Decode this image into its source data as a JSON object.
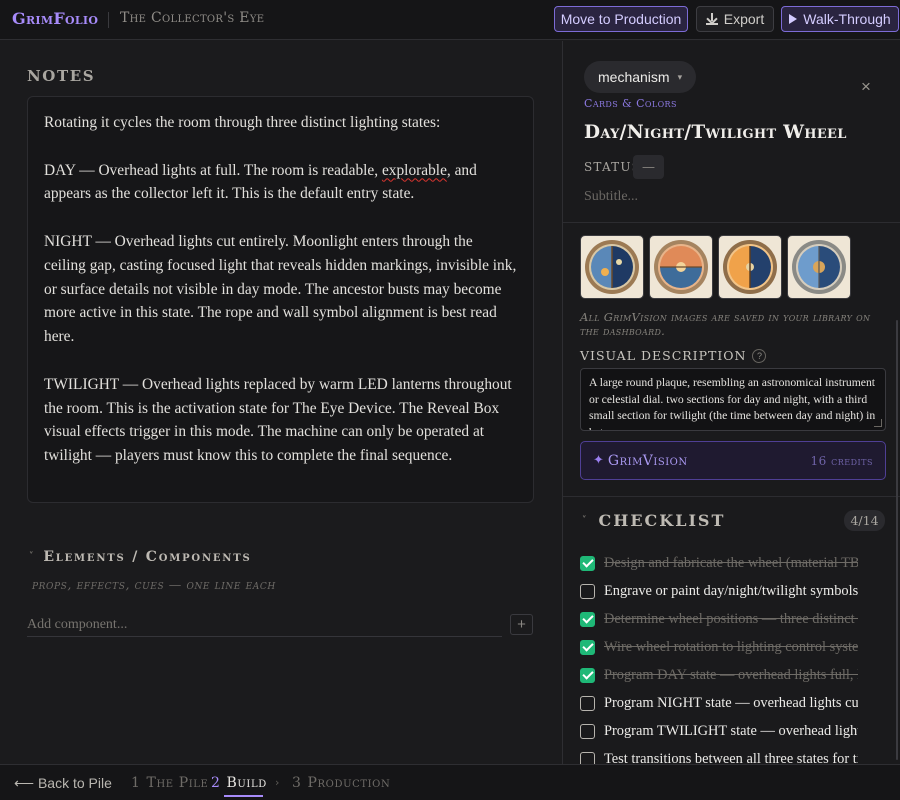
{
  "header": {
    "brand": "GrimFolio",
    "tagline": "The Collector's Eye",
    "move_to_production": "Move to Production",
    "export": "Export",
    "walk_through": "Walk-Through"
  },
  "notes": {
    "heading": "NOTES",
    "intro": "Rotating it cycles the room through three distinct lighting states:",
    "day_before": "DAY — Overhead lights at full. The room is readable, ",
    "day_misspelled": "explorable",
    "day_after": ", and appears as the collector left it. This is the default entry state.",
    "night": "NIGHT — Overhead lights cut entirely. Moonlight enters through the ceiling gap, casting focused light that reveals hidden markings, invisible ink, or surface details not visible in day mode. The ancestor busts may become more active in this state. The rope and wall symbol alignment is best read here.",
    "twilight": "TWILIGHT — Overhead lights replaced by warm LED lanterns throughout the room. This is the activation state for The Eye Device. The Reveal Box visual effects trigger in this mode. The machine can only be operated at twilight — players must know this to complete the final sequence."
  },
  "elements": {
    "heading": "Elements / Components",
    "subheading": "props, effects, cues — one line each",
    "placeholder": "Add component...",
    "add_glyph": "+"
  },
  "card": {
    "category": "mechanism",
    "category_caret": "▾",
    "close_glyph": "×",
    "section_label": "Cards & Colors",
    "title": "Day/Night/Twilight Wheel",
    "status_label": "STATUS",
    "status_value": "—",
    "subtitle_placeholder": "Subtitle...",
    "saved_note": "All GrimVision images are saved in your library on the dashboard.",
    "visual_description_label": "VISUAL DESCRIPTION",
    "help_glyph": "?",
    "visual_description": "A large round plaque,  resembling an astronomical instrument or celestial dial. two sections for  day and night, with a third small section for twilight (the time between day and night) in between.",
    "grimvision_label": "GrimVision",
    "grimvision_credits": "16 credits",
    "spark_glyph": "✦"
  },
  "checklist": {
    "heading": "CHECKLIST",
    "count": "4/14",
    "items": [
      {
        "text": "Design and fabricate the wheel (material TBD)",
        "done": true
      },
      {
        "text": "Engrave or paint day/night/twilight symbols",
        "done": false
      },
      {
        "text": "Determine wheel positions — three distinct stops",
        "done": true
      },
      {
        "text": "Wire wheel rotation to lighting control system",
        "done": true
      },
      {
        "text": "Program DAY state — overhead lights full, lanterns off",
        "done": true
      },
      {
        "text": "Program NIGHT state — overhead lights cut, moonlight on",
        "done": false
      },
      {
        "text": "Program TWILIGHT state — overhead lights off, lanterns on",
        "done": false
      },
      {
        "text": "Test transitions between all three states for timing",
        "done": false
      }
    ]
  },
  "footer": {
    "back": "⟵ Back to Pile",
    "steps": [
      {
        "num": "1",
        "label": "The Pile"
      },
      {
        "num": "2",
        "label": "Build"
      },
      {
        "num": "3",
        "label": "Production"
      }
    ],
    "chevron": "›"
  },
  "colors": {
    "accent": "#a78bfa",
    "checked": "#1fb877",
    "background": "#1b1b1d"
  }
}
